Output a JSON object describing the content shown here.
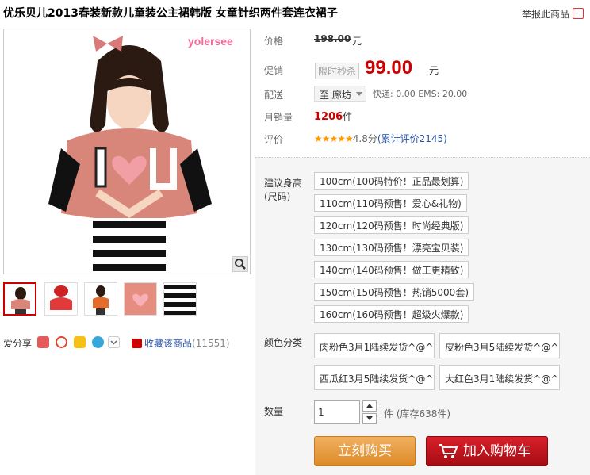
{
  "title": "优乐贝儿2013春装新款儿童装公主裙韩版 女童针织两件套连衣裙子",
  "report_link": "举报此商品",
  "main_image": {
    "brand_logo_text": "yolersee",
    "zoom_icon": "magnifier-icon"
  },
  "thumbnails": [
    {
      "name": "thumb-1",
      "active": true
    },
    {
      "name": "thumb-2",
      "active": false
    },
    {
      "name": "thumb-3",
      "active": false
    },
    {
      "name": "thumb-4",
      "active": false
    },
    {
      "name": "thumb-5",
      "active": false
    }
  ],
  "share": {
    "label": "爱分享",
    "icons": [
      "douban-icon",
      "weibo-icon",
      "qzone-icon",
      "share-bubble-icon",
      "chevron-down-icon"
    ]
  },
  "favorite": {
    "label": "收藏该商品",
    "count": "(11551)"
  },
  "price_info": {
    "price_label": "价格",
    "original_price": "198.00",
    "unit": "元",
    "promo_label": "促销",
    "promo_badge": "限时秒杀",
    "promo_price": "99.00",
    "shipping_label": "配送",
    "region": "至 廊坊",
    "shipping_detail": "快递: 0.00 EMS: 20.00",
    "sales_label": "月销量",
    "sales_count": "1206",
    "sales_unit": "件",
    "rating_label": "评价",
    "stars": "★★★★★",
    "score": "4.8分",
    "review_link": "(累计评价2145)"
  },
  "sku": {
    "size_label_line1": "建议身高",
    "size_label_line2": "(尺码)",
    "sizes": [
      "100cm(100码特价！正品最划算)",
      "110cm(110码预售！爱心&礼物)",
      "120cm(120码预售！时尚经典版)",
      "130cm(130码预售！漂亮宝贝装)",
      "140cm(140码预售！做工更精致)",
      "150cm(150码预售！热销5000套)",
      "160cm(160码预售！超级火爆款)"
    ],
    "color_label": "颜色分类",
    "colors": [
      "肉粉色3月1陆续发货^@^",
      "皮粉色3月5陆续发货^@^",
      "西瓜红3月5陆续发货^@^",
      "大红色3月1陆续发货^@^"
    ],
    "qty_label": "数量",
    "qty_value": "1",
    "stock_text": "件 (库存638件)"
  },
  "actions": {
    "buy_now": "立刻购买",
    "add_to_cart": "加入购物车"
  },
  "colors": {
    "price_red": "#cc0000",
    "link_blue": "#2953a6",
    "buy_orange": "#e59a3c",
    "cart_red": "#c0141c"
  }
}
